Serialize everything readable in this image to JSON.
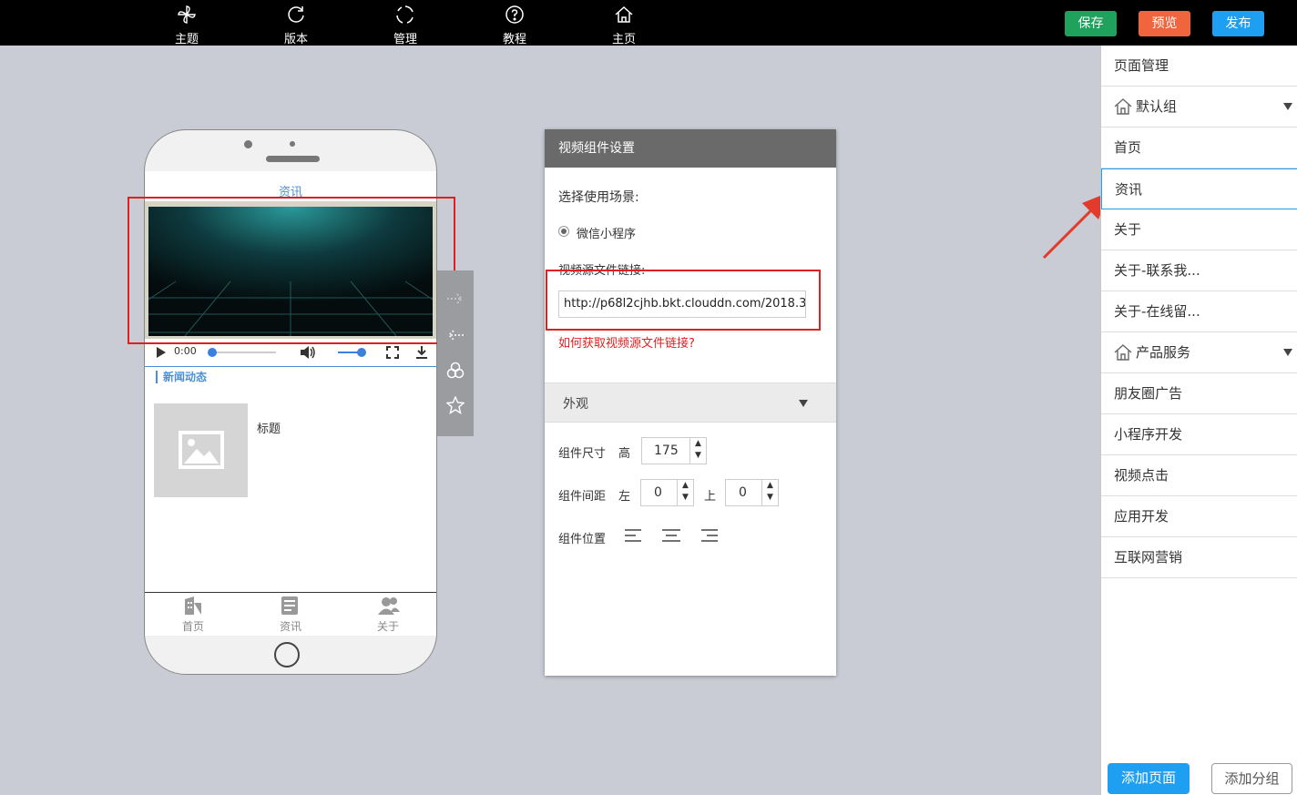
{
  "topbar": {
    "nav": [
      {
        "label": "主题",
        "icon": "pinwheel-icon"
      },
      {
        "label": "版本",
        "icon": "refresh-icon"
      },
      {
        "label": "管理",
        "icon": "circle-dots-icon"
      },
      {
        "label": "教程",
        "icon": "help-icon"
      },
      {
        "label": "主页",
        "icon": "home-icon"
      }
    ],
    "save": "保存",
    "preview": "预览",
    "publish": "发布",
    "colors": {
      "save": "#1fa25b",
      "preview": "#f0653e",
      "publish": "#1e9ff2"
    }
  },
  "phone": {
    "page_title": "资讯",
    "video_time": "0:00",
    "section_title": "新闻动态",
    "item_title": "标题",
    "tabs": [
      {
        "label": "首页",
        "icon": "building-icon"
      },
      {
        "label": "资讯",
        "icon": "news-icon"
      },
      {
        "label": "关于",
        "icon": "users-icon"
      }
    ]
  },
  "settings": {
    "title": "视频组件设置",
    "scene_label": "选择使用场景:",
    "scene_option": "微信小程序",
    "url_label": "视频源文件链接:",
    "url_value": "http://p68l2cjhb.bkt.clouddn.com/2018.3.",
    "help_link": "如何获取视频源文件链接?",
    "appearance": "外观",
    "size_label": "组件尺寸",
    "height_label": "高",
    "height_value": "175",
    "spacing_label": "组件间距",
    "left_label": "左",
    "left_value": "0",
    "top_label": "上",
    "top_value": "0",
    "position_label": "组件位置"
  },
  "pages": {
    "title": "页面管理",
    "items": [
      {
        "label": "默认组",
        "group": true
      },
      {
        "label": "首页"
      },
      {
        "label": "资讯",
        "active": true
      },
      {
        "label": "关于"
      },
      {
        "label": "关于-联系我..."
      },
      {
        "label": "关于-在线留..."
      },
      {
        "label": "产品服务",
        "group": true
      },
      {
        "label": "朋友圈广告"
      },
      {
        "label": "小程序开发"
      },
      {
        "label": "视频点击"
      },
      {
        "label": "应用开发"
      },
      {
        "label": "互联网营销"
      }
    ],
    "add_page": "添加页面",
    "add_group": "添加分组"
  }
}
